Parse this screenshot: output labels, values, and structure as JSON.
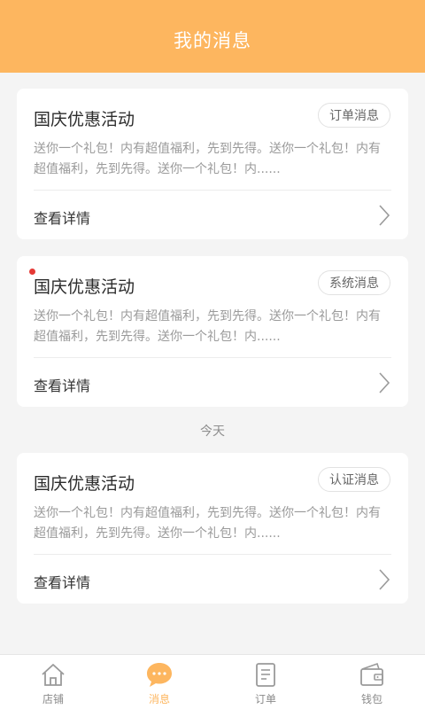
{
  "header": {
    "title": "我的消息"
  },
  "messages": [
    {
      "title": "国庆优惠活动",
      "tag": "订单消息",
      "desc": "送你一个礼包！内有超值福利，先到先得。送你一个礼包！内有超值福利，先到先得。送你一个礼包！内......",
      "detail": "查看详情",
      "unread": false
    },
    {
      "title": "国庆优惠活动",
      "tag": "系统消息",
      "desc": "送你一个礼包！内有超值福利，先到先得。送你一个礼包！内有超值福利，先到先得。送你一个礼包！内......",
      "detail": "查看详情",
      "unread": true
    },
    {
      "title": "国庆优惠活动",
      "tag": "认证消息",
      "desc": "送你一个礼包！内有超值福利，先到先得。送你一个礼包！内有超值福利，先到先得。送你一个礼包！内......",
      "detail": "查看详情",
      "unread": false
    }
  ],
  "date_separator": "今天",
  "tabbar": {
    "items": [
      {
        "label": "店铺",
        "icon": "store-icon",
        "active": false
      },
      {
        "label": "消息",
        "icon": "message-icon",
        "active": true
      },
      {
        "label": "订单",
        "icon": "order-icon",
        "active": false
      },
      {
        "label": "钱包",
        "icon": "wallet-icon",
        "active": false
      }
    ]
  },
  "colors": {
    "accent": "#fdb65f",
    "unread_dot": "#e53935",
    "background": "#f4f4f4"
  }
}
